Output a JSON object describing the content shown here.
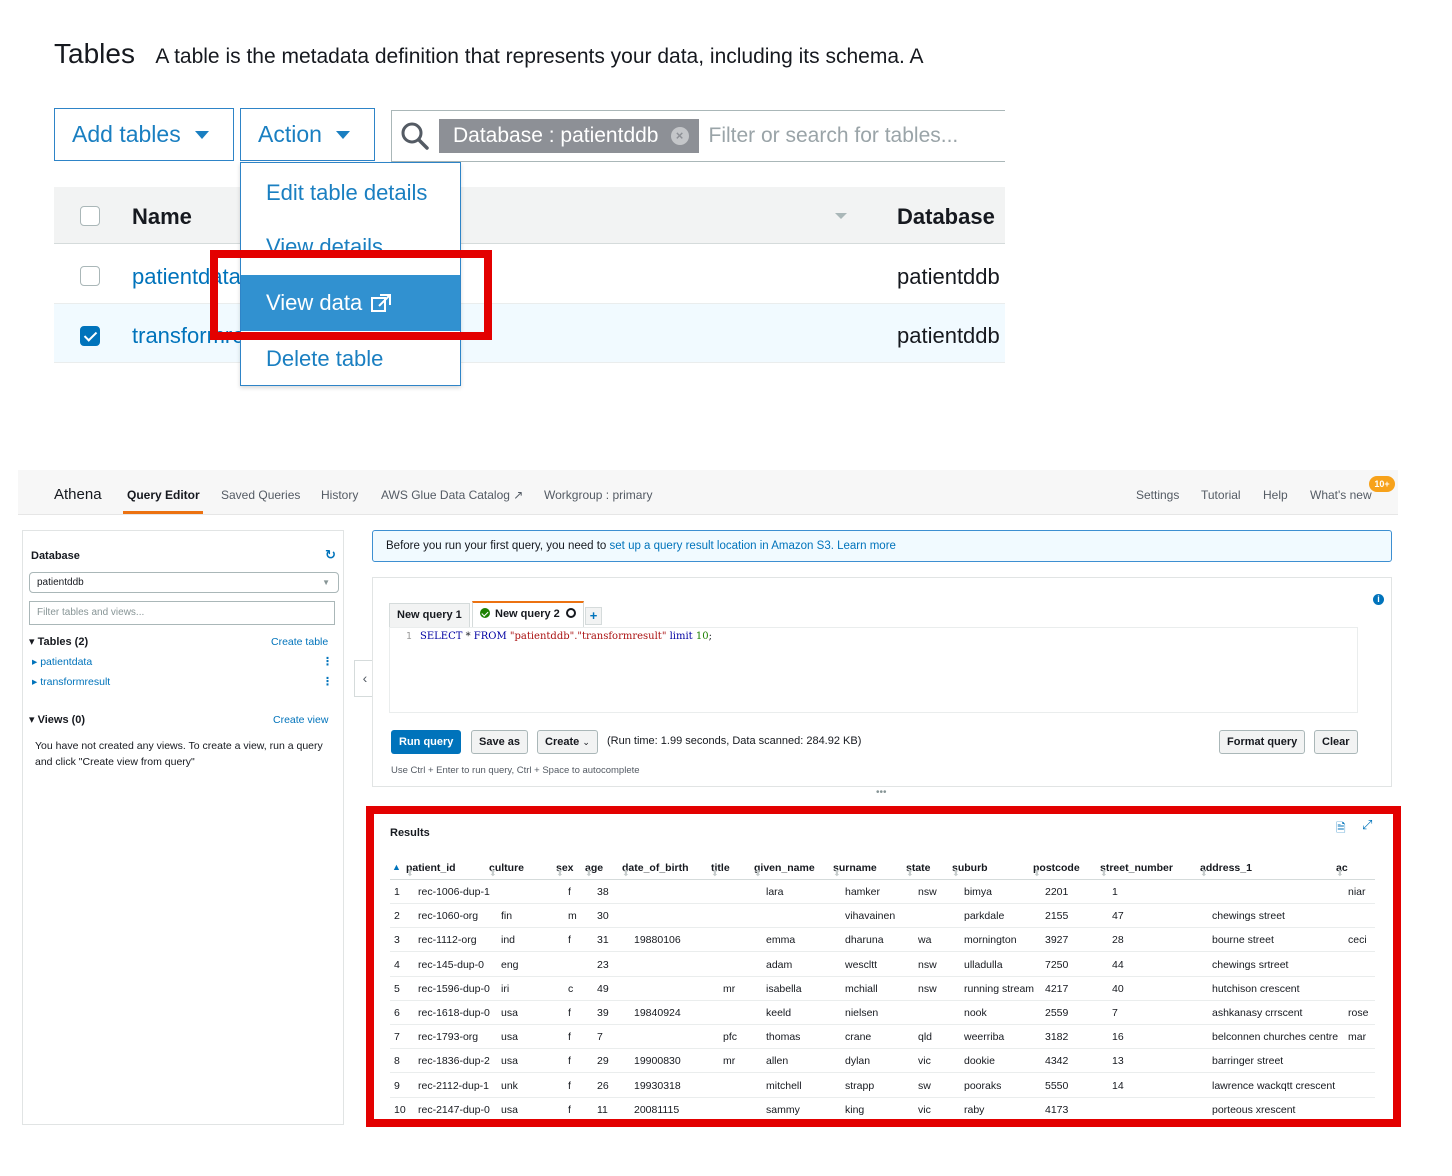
{
  "glue": {
    "title": "Tables",
    "description": "A table is the metadata definition that represents your data, including its schema. A",
    "add_tables_label": "Add tables",
    "action_label": "Action",
    "filter_token": "Database : patientddb",
    "search_placeholder": "Filter or search for tables...",
    "columns": {
      "name": "Name",
      "database": "Database"
    },
    "rows": [
      {
        "name": "patientdata",
        "database": "patientddb",
        "selected": false
      },
      {
        "name": "transformresult",
        "database": "patientddb",
        "selected": true
      }
    ],
    "action_menu": [
      "Edit table details",
      "View details",
      "View data",
      "Delete table"
    ],
    "highlight_color": "#e30000"
  },
  "athena": {
    "nav": {
      "brand": "Athena",
      "query_editor": "Query Editor",
      "saved_queries": "Saved Queries",
      "history": "History",
      "glue_catalog": "AWS Glue Data Catalog",
      "workgroup": "Workgroup : primary",
      "settings": "Settings",
      "tutorial": "Tutorial",
      "help": "Help",
      "whats_new": "What's new",
      "badge": "10+"
    },
    "left": {
      "database_title": "Database",
      "database_selected": "patientddb",
      "filter_placeholder": "Filter tables and views...",
      "tables_header": "Tables (2)",
      "create_table": "Create table",
      "tables": [
        "patientdata",
        "transformresult"
      ],
      "views_header": "Views (0)",
      "create_view": "Create view",
      "views_empty": "You have not created any views. To create a view, run a query and click \"Create view from query\""
    },
    "banner": {
      "text": "Before you run your first query, you need to ",
      "link": "set up a query result location in Amazon S3.",
      "learn_more": "Learn more"
    },
    "editor": {
      "tab1": "New query 1",
      "tab2": "New query 2",
      "line_number": "1",
      "sql_select": "SELECT",
      "sql_star": " * ",
      "sql_from": "FROM",
      "sql_table": "\"patientddb\".\"transformresult\"",
      "sql_limit": "limit",
      "sql_num": "10",
      "sql_end": ";",
      "run_label": "Run query",
      "save_as_label": "Save as",
      "create_label": "Create",
      "run_stats": "(Run time: 1.99 seconds, Data scanned: 284.92 KB)",
      "format_label": "Format query",
      "clear_label": "Clear",
      "hint": "Use Ctrl + Enter to run query, Ctrl + Space to autocomplete"
    },
    "results": {
      "title": "Results",
      "columns": [
        "patient_id",
        "culture",
        "sex",
        "age",
        "date_of_birth",
        "title",
        "given_name",
        "surname",
        "state",
        "suburb",
        "postcode",
        "street_number",
        "address_1",
        "ac"
      ],
      "rows": [
        [
          "1",
          "rec-1006-dup-1",
          "",
          "f",
          "38",
          "",
          "",
          "lara",
          "hamker",
          "nsw",
          "bimya",
          "2201",
          "1",
          "",
          "niar"
        ],
        [
          "2",
          "rec-1060-org",
          "fin",
          "m",
          "30",
          "",
          "",
          "",
          "vihavainen",
          "",
          "parkdale",
          "2155",
          "47",
          "chewings street",
          ""
        ],
        [
          "3",
          "rec-1112-org",
          "ind",
          "f",
          "31",
          "19880106",
          "",
          "emma",
          "dharuna",
          "wa",
          "mornington",
          "3927",
          "28",
          "bourne street",
          "ceci"
        ],
        [
          "4",
          "rec-145-dup-0",
          "eng",
          "",
          "23",
          "",
          "",
          "adam",
          "wescltt",
          "nsw",
          "ulladulla",
          "7250",
          "44",
          "chewings srtreet",
          ""
        ],
        [
          "5",
          "rec-1596-dup-0",
          "iri",
          "c",
          "49",
          "",
          "mr",
          "isabella",
          "mchiall",
          "nsw",
          "running stream",
          "4217",
          "40",
          "hutchison crescent",
          ""
        ],
        [
          "6",
          "rec-1618-dup-0",
          "usa",
          "f",
          "39",
          "19840924",
          "",
          "keeld",
          "nielsen",
          "",
          "nook",
          "2559",
          "7",
          "ashkanasy crrscent",
          "rose"
        ],
        [
          "7",
          "rec-1793-org",
          "usa",
          "f",
          "7",
          "",
          "pfc",
          "thomas",
          "crane",
          "qld",
          "weerriba",
          "3182",
          "16",
          "belconnen churches centre",
          "mar"
        ],
        [
          "8",
          "rec-1836-dup-2",
          "usa",
          "f",
          "29",
          "19900830",
          "mr",
          "allen",
          "dylan",
          "vic",
          "dookie",
          "4342",
          "13",
          "barringer street",
          ""
        ],
        [
          "9",
          "rec-2112-dup-1",
          "unk",
          "f",
          "26",
          "19930318",
          "",
          "mitchell",
          "strapp",
          "sw",
          "pooraks",
          "5550",
          "14",
          "lawrence wackqtt crescent",
          ""
        ],
        [
          "10",
          "rec-2147-dup-0",
          "usa",
          "f",
          "11",
          "20081115",
          "",
          "sammy",
          "king",
          "vic",
          "raby",
          "4173",
          "",
          "porteous xrescent",
          ""
        ]
      ]
    }
  }
}
